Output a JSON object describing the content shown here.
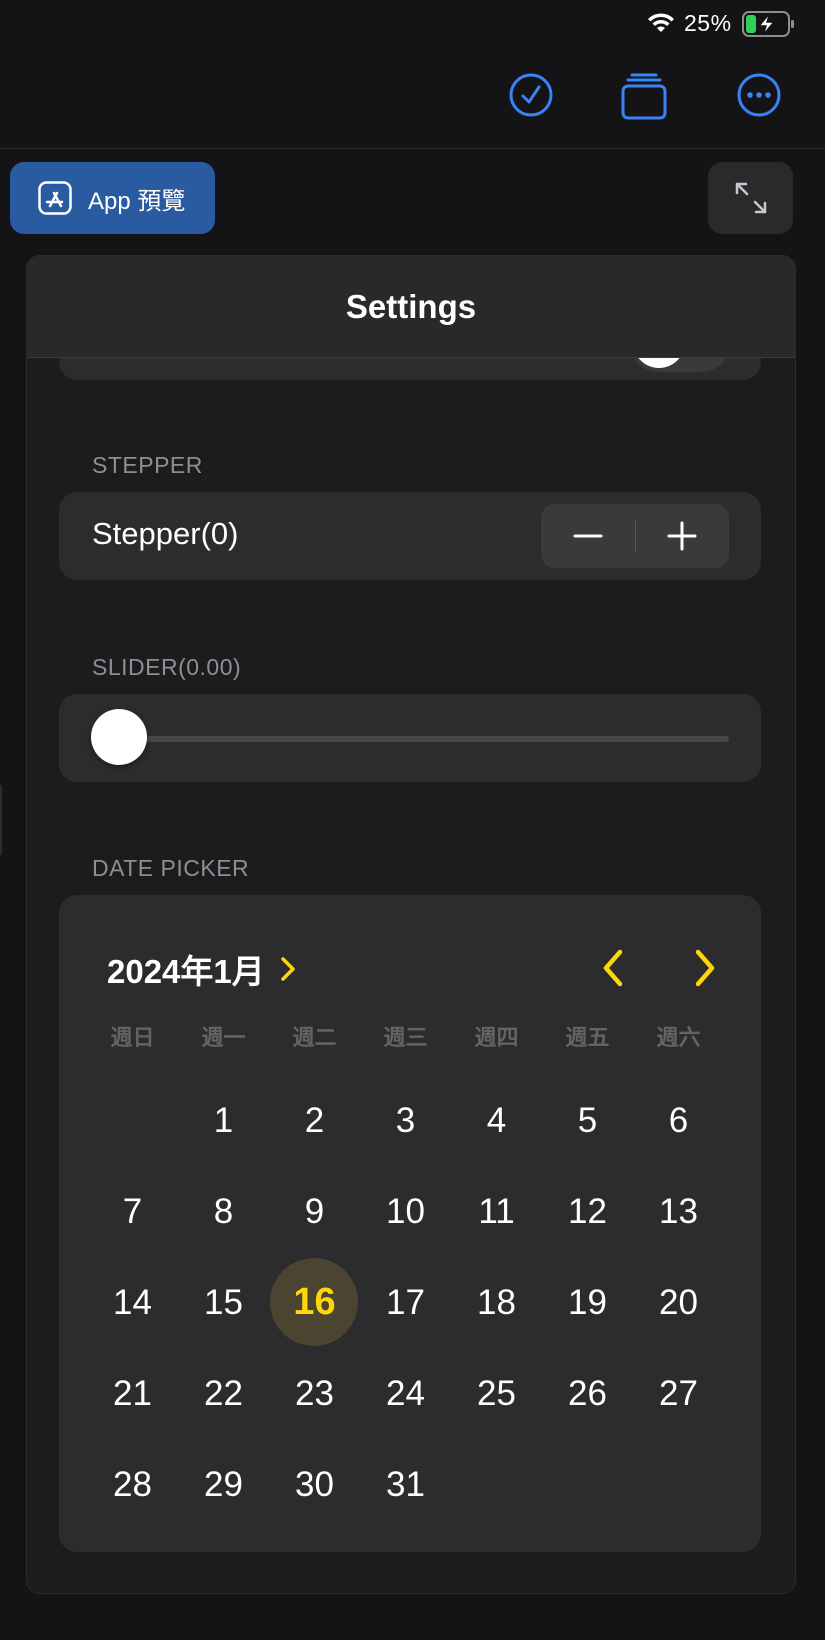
{
  "status_bar": {
    "battery_percent": "25%",
    "battery_level": 0.25,
    "wifi_icon": "wifi-icon",
    "battery_icon": "battery-charging-icon"
  },
  "toolbar": {
    "icons": [
      "checkmark-circle-icon",
      "stack-icon",
      "more-circle-icon"
    ],
    "accent_color": "#3a82f7"
  },
  "preview_button": {
    "label": "App 預覽",
    "icon": "app-store-icon",
    "color": "#2a5aa0"
  },
  "expand_button": {
    "icon": "expand-arrows-icon"
  },
  "panel": {
    "title": "Settings",
    "toggle": {
      "on": false
    },
    "stepper": {
      "section": "STEPPER",
      "label": "Stepper(0)",
      "value": 0
    },
    "slider": {
      "section": "SLIDER(0.00)",
      "value": 0.0
    },
    "date_picker": {
      "section": "DATE PICKER",
      "month_label": "2024年1月",
      "accent_color": "#ffd60a",
      "weekdays": [
        "週日",
        "週一",
        "週二",
        "週三",
        "週四",
        "週五",
        "週六"
      ],
      "first_weekday_index": 1,
      "days_in_month": 31,
      "selected_day": 16
    }
  }
}
